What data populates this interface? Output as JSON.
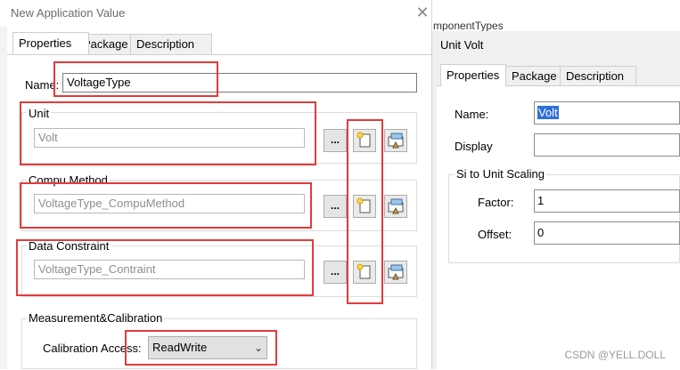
{
  "left_dialog": {
    "title": "New Application Value",
    "tabs": [
      "Properties",
      "Package",
      "Description"
    ],
    "name_label": "Name:",
    "name_value": "VoltageType",
    "groups": [
      {
        "title": "Unit",
        "value": "Volt"
      },
      {
        "title": "Compu Method",
        "value": "VoltageType_CompuMethod"
      },
      {
        "title": "Data Constraint",
        "value": "VoltageType_Contraint"
      }
    ],
    "ellipsis_label": "...",
    "measurement": {
      "title": "Measurement&Calibration",
      "calibration_label": "Calibration Access:",
      "calibration_value": "ReadWrite"
    }
  },
  "right_dialog": {
    "background_text": "mponentTypes",
    "title": "Unit Volt",
    "tabs": [
      "Properties",
      "Package",
      "Description"
    ],
    "name_label": "Name:",
    "name_value": "Volt",
    "display_label": "Display",
    "display_value": "",
    "scaling_title": "Si to Unit Scaling",
    "factor_label": "Factor:",
    "factor_value": "1",
    "offset_label": "Offset:",
    "offset_value": "0"
  },
  "watermark": "CSDN @YELL.DOLL",
  "icons": {
    "close": "close-icon",
    "new": "new-item-icon",
    "edit": "edit-item-icon",
    "dropdown": "chevron-down-icon"
  },
  "colors": {
    "highlight": "#e33b3b",
    "selection": "#2f6fd6"
  }
}
